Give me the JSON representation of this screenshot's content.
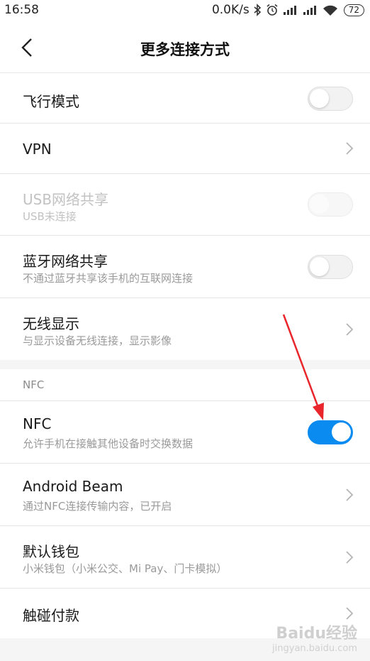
{
  "status": {
    "time": "16:58",
    "speed": "0.0K/s",
    "battery": "72",
    "icons": [
      "bluetooth-icon",
      "alarm-icon",
      "signal-icon",
      "signal-icon",
      "wifi-icon",
      "battery-icon"
    ]
  },
  "header": {
    "title": "更多连接方式"
  },
  "rows": {
    "airplane": {
      "label": "飞行模式",
      "toggle": "off"
    },
    "vpn": {
      "label": "VPN"
    },
    "usb": {
      "label": "USB网络共享",
      "sub": "USB未连接",
      "toggle": "disabled"
    },
    "bt": {
      "label": "蓝牙网络共享",
      "sub": "不通过蓝牙共享该手机的互联网连接",
      "toggle": "off"
    },
    "wireless": {
      "label": "无线显示",
      "sub": "与显示设备无线连接，显示影像"
    },
    "nfc": {
      "label": "NFC",
      "sub": "允许手机在接触其他设备时交换数据",
      "toggle": "on"
    },
    "beam": {
      "label": "Android Beam",
      "sub": "通过NFC连接传输内容，已开启"
    },
    "wallet": {
      "label": "默认钱包",
      "sub": "小米钱包（小米公交、Mi Pay、门卡模拟）"
    },
    "tap": {
      "label": "触碰付款"
    }
  },
  "section": {
    "nfc_title": "NFC"
  },
  "colors": {
    "accent": "#0a8bf0",
    "annotation_arrow": "#e8262b"
  },
  "watermark": {
    "brand": "Baidu经验",
    "url": "jingyan.baidu.com"
  }
}
